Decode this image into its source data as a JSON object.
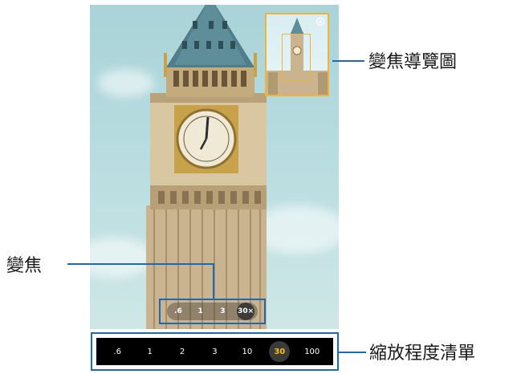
{
  "callouts": {
    "zoom_map": "變焦導覽圖",
    "zoom": "變焦",
    "zoom_list": "縮放程度清單"
  },
  "zoom_pill": {
    "levels": [
      ".6",
      "1",
      "3",
      "30×"
    ],
    "selected": "30×"
  },
  "zoom_bar": {
    "levels": [
      ".6",
      "1",
      "2",
      "3",
      "10",
      "30",
      "100"
    ],
    "selected": "30"
  },
  "icons": {
    "zoom_map_corner": "camera-shutter-icon"
  },
  "colors": {
    "callout_line": "#1d6ab2",
    "zoom_map_frame": "#f1b43a",
    "active_zoom_text": "#f5c400"
  }
}
